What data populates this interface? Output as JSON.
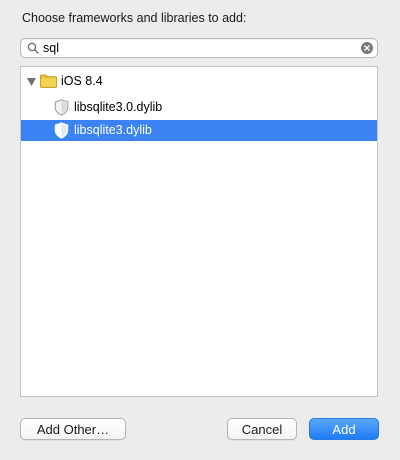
{
  "dialog": {
    "prompt": "Choose frameworks and libraries to add:"
  },
  "search": {
    "value": "sql",
    "icons": {
      "left": "magnifier-icon",
      "right": "clear-icon"
    }
  },
  "tree": {
    "group": {
      "label": "iOS 8.4",
      "expanded": true,
      "icon": "folder-icon"
    },
    "items": [
      {
        "label": "libsqlite3.0.dylib",
        "selected": false,
        "icon": "library-shield-icon"
      },
      {
        "label": "libsqlite3.dylib",
        "selected": true,
        "icon": "library-shield-icon"
      }
    ]
  },
  "buttons": {
    "add_other": "Add Other…",
    "cancel": "Cancel",
    "add": "Add"
  },
  "colors": {
    "selection": "#3b82f2",
    "primary_button": "#1e7cf3",
    "folder": "#e6c334",
    "background": "#ececec"
  }
}
